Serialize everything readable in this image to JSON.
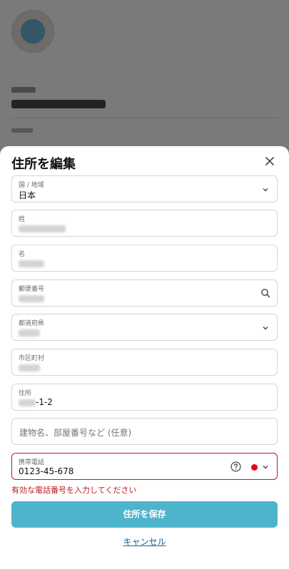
{
  "sheet": {
    "title": "住所を編集",
    "fields": {
      "country": {
        "label": "国 / 地域",
        "value": "日本"
      },
      "last_name": {
        "label": "姓"
      },
      "first_name": {
        "label": "名"
      },
      "postal_code": {
        "label": "郵便番号"
      },
      "prefecture": {
        "label": "都道府県"
      },
      "city": {
        "label": "市区町村"
      },
      "address": {
        "label": "住所",
        "value_suffix": "-1-2"
      },
      "building": {
        "placeholder": "建物名、部屋番号など (任意)"
      },
      "phone": {
        "label": "携帯電話",
        "value": "0123-45-678",
        "flag_color": "#e60012"
      }
    },
    "error_message": "有効な電話番号を入力してください",
    "save_label": "住所を保存",
    "cancel_label": "キャンセル"
  },
  "colors": {
    "accent": "#4eb4cc",
    "error": "#c01818",
    "link": "#1a5f86"
  },
  "icons": [
    "close-icon",
    "chevron-down-icon",
    "search-icon",
    "help-icon",
    "japan-flag-icon"
  ]
}
